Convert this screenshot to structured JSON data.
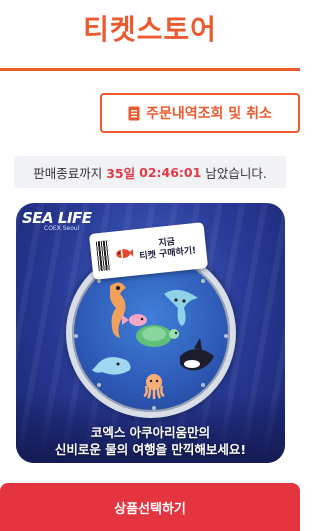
{
  "header": {
    "title": "티켓스토어"
  },
  "order_button": {
    "label": "주문내역조회 및 취소",
    "icon": "document-icon"
  },
  "countdown": {
    "prefix": "판매종료까지",
    "days": "35일",
    "time": "02:46:01",
    "suffix": "남았습니다."
  },
  "banner": {
    "logo": {
      "brand": "SEA LIFE",
      "sub": "COEX Seoul"
    },
    "ticket": {
      "line1": "지금",
      "line2": "티켓 구매하기!"
    },
    "caption": {
      "line1": "코엑스 아쿠아리움만의",
      "line2": "신비로운 물의 여행을 만끽해보세요!"
    }
  },
  "cta": {
    "label": "상품선택하기"
  },
  "colors": {
    "accent": "#ee5a30",
    "cta": "#e4343f",
    "time": "#e23a46"
  }
}
